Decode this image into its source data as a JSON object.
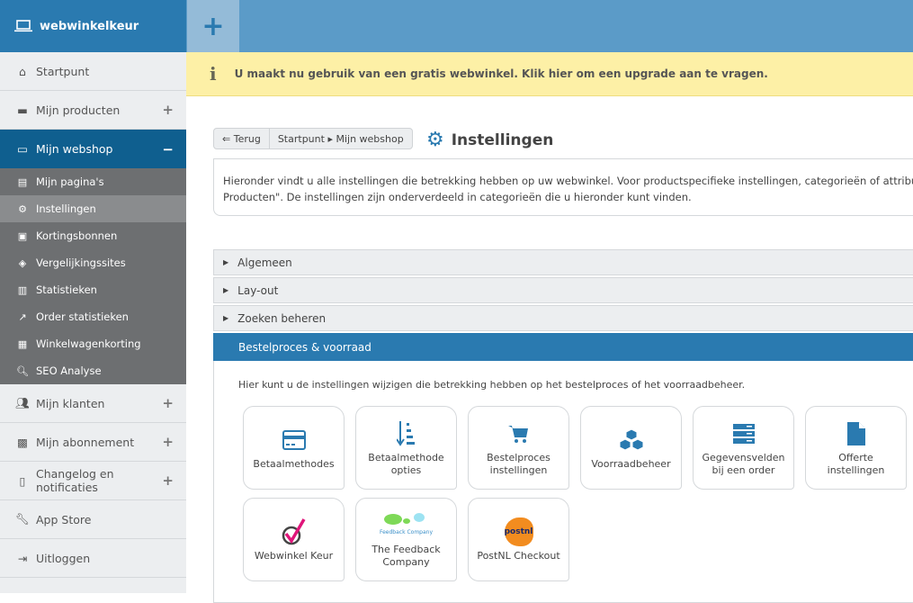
{
  "brand": "webwinkelkeur",
  "nav_top": [
    {
      "label": "Startpunt",
      "icon": "home-icon"
    },
    {
      "label": "Mijn producten",
      "icon": "archive-icon",
      "toggle": "+"
    },
    {
      "label": "Mijn webshop",
      "icon": "laptop-icon",
      "toggle": "−"
    }
  ],
  "sub": [
    "Mijn pagina's",
    "Instellingen",
    "Kortingsbonnen",
    "Vergelijkingssites",
    "Statistieken",
    "Order statistieken",
    "Winkelwagenkorting",
    "SEO Analyse"
  ],
  "nav_bottom": [
    {
      "label": "Mijn klanten",
      "toggle": "+"
    },
    {
      "label": "Mijn abonnement",
      "toggle": "+"
    },
    {
      "label": "Changelog en notificaties",
      "toggle": "+"
    },
    {
      "label": "App Store"
    },
    {
      "label": "Uitloggen"
    }
  ],
  "topbar": {
    "plus": "+"
  },
  "banner": {
    "icon": "i",
    "text": "U maakt nu gebruik van een gratis webwinkel. Klik hier om een upgrade aan te vragen."
  },
  "breadcrumb": {
    "back": "Terug",
    "path": [
      "Startpunt",
      "Mijn webshop"
    ]
  },
  "page_title": "Instellingen",
  "description": [
    "Hieronder vindt u alle instellingen die betrekking hebben op uw webwinkel. Voor productspecifieke instellingen, categorieën of attributens",
    "Producten\". De instellingen zijn onderverdeeld in categorieën die u hieronder kunt vinden."
  ],
  "accordion": [
    "Algemeen",
    "Lay-out",
    "Zoeken beheren",
    "Bestelproces & voorraad"
  ],
  "panel_text": "Hier kunt u de instellingen wijzigen die betrekking hebben op het bestelproces of het voorraadbeheer.",
  "tiles": [
    "Betaalmethodes",
    "Betaalmethode opties",
    "Bestelproces instellingen",
    "Voorraadbeheer",
    "Gegevensvelden bij een order",
    "Offerte instellingen",
    "Webwinkel Keur",
    "The Feedback Company",
    "PostNL Checkout"
  ],
  "logos": {
    "feedback": "Feedback Company",
    "postnl": "postnl"
  },
  "colors": {
    "primary": "#2a7ab0",
    "active": "#0f5f8f",
    "banner": "#fdf0a6"
  }
}
